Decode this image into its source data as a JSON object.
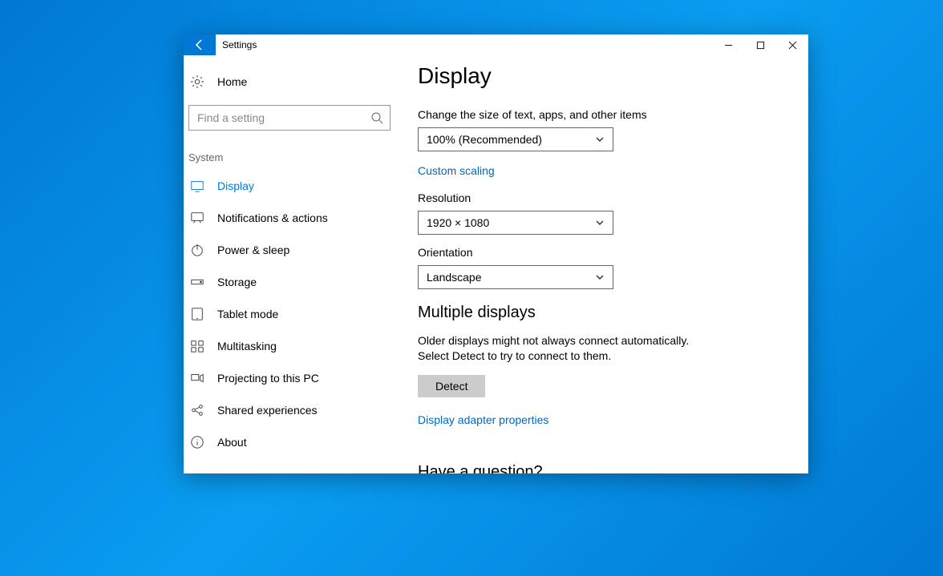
{
  "titlebar": {
    "title": "Settings"
  },
  "sidebar": {
    "home_label": "Home",
    "search_placeholder": "Find a setting",
    "section_label": "System",
    "items": [
      {
        "icon": "display",
        "label": "Display",
        "active": true
      },
      {
        "icon": "notifications",
        "label": "Notifications & actions",
        "active": false
      },
      {
        "icon": "power",
        "label": "Power & sleep",
        "active": false
      },
      {
        "icon": "storage",
        "label": "Storage",
        "active": false
      },
      {
        "icon": "tablet",
        "label": "Tablet mode",
        "active": false
      },
      {
        "icon": "multitasking",
        "label": "Multitasking",
        "active": false
      },
      {
        "icon": "projecting",
        "label": "Projecting to this PC",
        "active": false
      },
      {
        "icon": "shared",
        "label": "Shared experiences",
        "active": false
      },
      {
        "icon": "about",
        "label": "About",
        "active": false
      }
    ]
  },
  "content": {
    "page_title": "Display",
    "scale_label": "Change the size of text, apps, and other items",
    "scale_value": "100% (Recommended)",
    "custom_scaling_link": "Custom scaling",
    "resolution_label": "Resolution",
    "resolution_value": "1920 × 1080",
    "orientation_label": "Orientation",
    "orientation_value": "Landscape",
    "multiple_displays_heading": "Multiple displays",
    "multiple_displays_text": "Older displays might not always connect automatically. Select Detect to try to connect to them.",
    "detect_button": "Detect",
    "adapter_link": "Display adapter properties",
    "question_heading": "Have a question?"
  }
}
